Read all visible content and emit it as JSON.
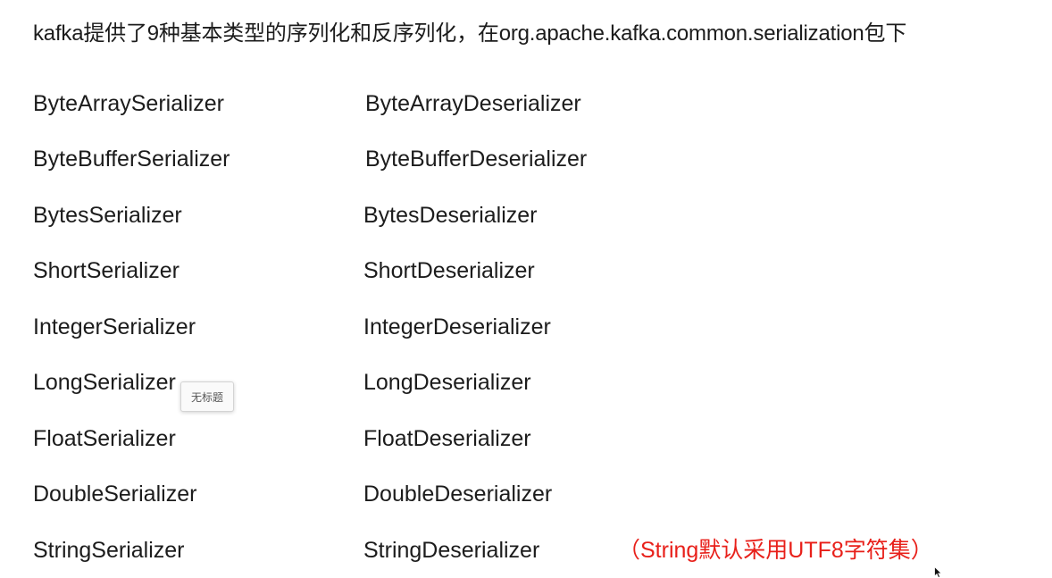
{
  "headline": "kafka提供了9种基本类型的序列化和反序列化，在org.apache.kafka.common.serialization包下",
  "rows": [
    {
      "serializer": "ByteArraySerializer",
      "deserializer": "ByteArrayDeserializer"
    },
    {
      "serializer": "ByteBufferSerializer",
      "deserializer": "ByteBufferDeserializer"
    },
    {
      "serializer": "BytesSerializer",
      "deserializer": "BytesDeserializer"
    },
    {
      "serializer": "ShortSerializer",
      "deserializer": "ShortDeserializer"
    },
    {
      "serializer": "IntegerSerializer",
      "deserializer": "IntegerDeserializer"
    },
    {
      "serializer": "LongSerializer",
      "deserializer": "LongDeserializer"
    },
    {
      "serializer": "FloatSerializer",
      "deserializer": "FloatDeserializer"
    },
    {
      "serializer": "DoubleSerializer",
      "deserializer": "DoubleDeserializer"
    },
    {
      "serializer": "StringSerializer",
      "deserializer": "StringDeserializer",
      "note": "（String默认采用UTF8字符集）"
    }
  ],
  "tooltip": "无标题",
  "colors": {
    "text": "#1c1c1c",
    "note": "#e8201a",
    "background": "#ffffff"
  },
  "icons": {
    "cursor": "mouse-pointer-icon"
  }
}
